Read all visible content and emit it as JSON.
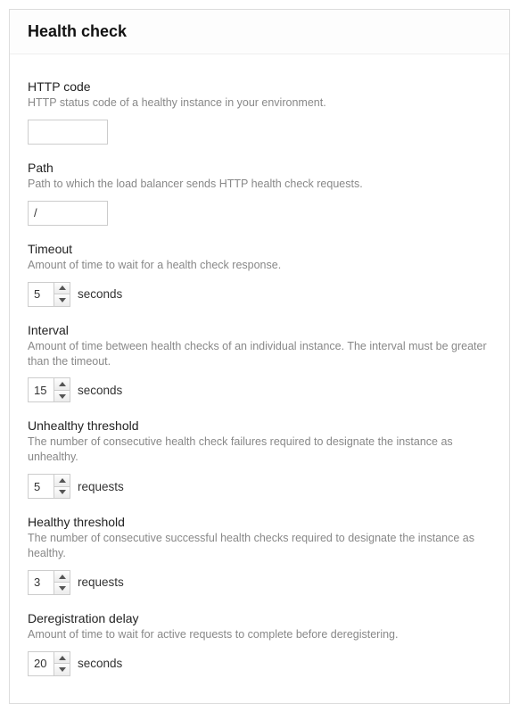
{
  "panel": {
    "title": "Health check"
  },
  "fields": {
    "http_code": {
      "label": "HTTP code",
      "help": "HTTP status code of a healthy instance in your environment.",
      "value": ""
    },
    "path": {
      "label": "Path",
      "help": "Path to which the load balancer sends HTTP health check requests.",
      "value": "/"
    },
    "timeout": {
      "label": "Timeout",
      "help": "Amount of time to wait for a health check response.",
      "value": "5",
      "unit": "seconds"
    },
    "interval": {
      "label": "Interval",
      "help": "Amount of time between health checks of an individual instance. The interval must be greater than the timeout.",
      "value": "15",
      "unit": "seconds"
    },
    "unhealthy_threshold": {
      "label": "Unhealthy threshold",
      "help": "The number of consecutive health check failures required to designate the instance as unhealthy.",
      "value": "5",
      "unit": "requests"
    },
    "healthy_threshold": {
      "label": "Healthy threshold",
      "help": "The number of consecutive successful health checks required to designate the instance as healthy.",
      "value": "3",
      "unit": "requests"
    },
    "deregistration_delay": {
      "label": "Deregistration delay",
      "help": "Amount of time to wait for active requests to complete before deregistering.",
      "value": "20",
      "unit": "seconds"
    }
  }
}
